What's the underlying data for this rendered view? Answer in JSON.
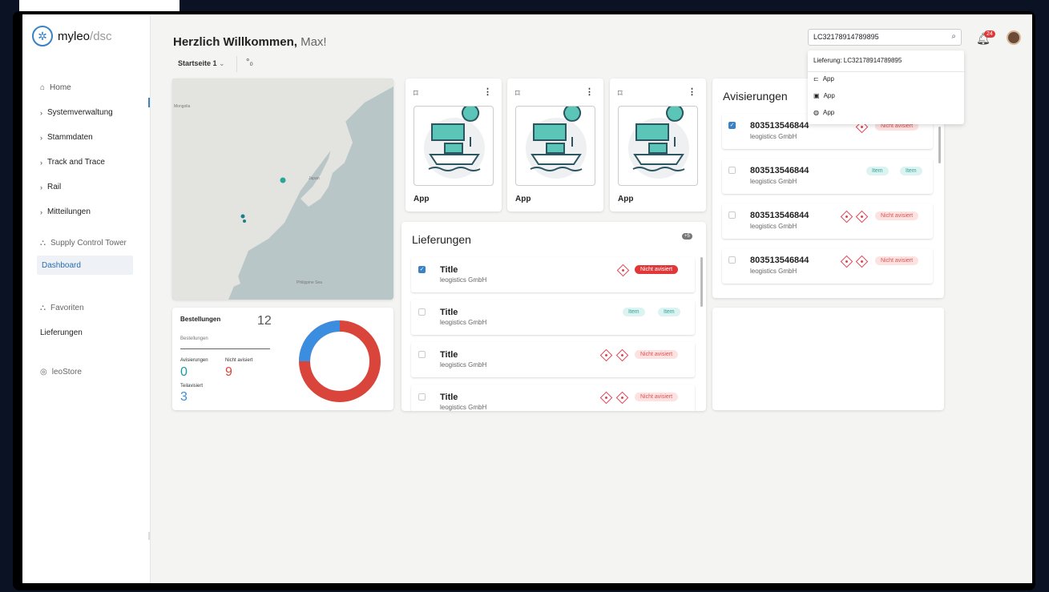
{
  "app": {
    "logo_main": "myleo",
    "logo_slash": "/",
    "logo_sub": "dsc"
  },
  "sidebar": {
    "items": [
      {
        "label": "Home"
      },
      {
        "label": "Systemverwaltung"
      },
      {
        "label": "Stammdaten"
      },
      {
        "label": "Track and Trace"
      },
      {
        "label": "Rail"
      },
      {
        "label": "Mitteilungen"
      },
      {
        "label": "Supply Control Tower"
      },
      {
        "label": "Dashboard"
      },
      {
        "label": "Favoriten"
      },
      {
        "label": "Lieferungen"
      },
      {
        "label": "leoStore"
      }
    ]
  },
  "header": {
    "greeting": "Herzlich Willkommen,",
    "name": "Max!",
    "page_select": "Startseite 1"
  },
  "search": {
    "value": "LC32178914789895",
    "dropdown_header": "Lieferung: LC32178914789895",
    "results": [
      "App",
      "App",
      "App"
    ]
  },
  "notifications": {
    "count": "24"
  },
  "map": {
    "labels": {
      "mongolia": "Mongolia",
      "japan": "Japan",
      "philippine": "Philippine Sea"
    }
  },
  "bestellungen": {
    "title": "Bestellungen",
    "count": "12",
    "sub": "Bestellungen",
    "avisierungen_label": "Avisierungen",
    "avisierungen_value": "0",
    "nicht_label": "Nicht avisiert",
    "nicht_value": "9",
    "teil_label": "Teilavisiert",
    "teil_value": "3",
    "colors": {
      "blue": "#3b8de0",
      "red": "#d9453b",
      "teal": "#1c9aa8"
    }
  },
  "apps": [
    {
      "name": "App"
    },
    {
      "name": "App"
    },
    {
      "name": "App"
    }
  ],
  "lieferungen": {
    "title": "Lieferungen",
    "count": "+5",
    "rows": [
      {
        "title": "Title",
        "company": "leogistics GmbH",
        "badge": "Nicht avisiert",
        "checked": true
      },
      {
        "title": "Title",
        "company": "leogistics GmbH",
        "badges": [
          "Item",
          "Item"
        ],
        "checked": false
      },
      {
        "title": "Title",
        "company": "leogistics GmbH",
        "badge": "Nicht avisiert",
        "checked": false
      },
      {
        "title": "Title",
        "company": "leogistics GmbH",
        "badge": "Nicht avisiert",
        "checked": false
      }
    ]
  },
  "avisierungen": {
    "title": "Avisierungen",
    "rows": [
      {
        "id": "803513546844",
        "company": "leogistics GmbH",
        "badge": "Nicht avisiert",
        "checked": true
      },
      {
        "id": "803513546844",
        "company": "leogistics GmbH",
        "badges": [
          "Item",
          "Item"
        ],
        "checked": false
      },
      {
        "id": "803513546844",
        "company": "leogistics GmbH",
        "badge": "Nicht avisiert",
        "checked": false
      },
      {
        "id": "803513546844",
        "company": "leogistics GmbH",
        "badge": "Nicht avisiert",
        "checked": false
      }
    ]
  }
}
